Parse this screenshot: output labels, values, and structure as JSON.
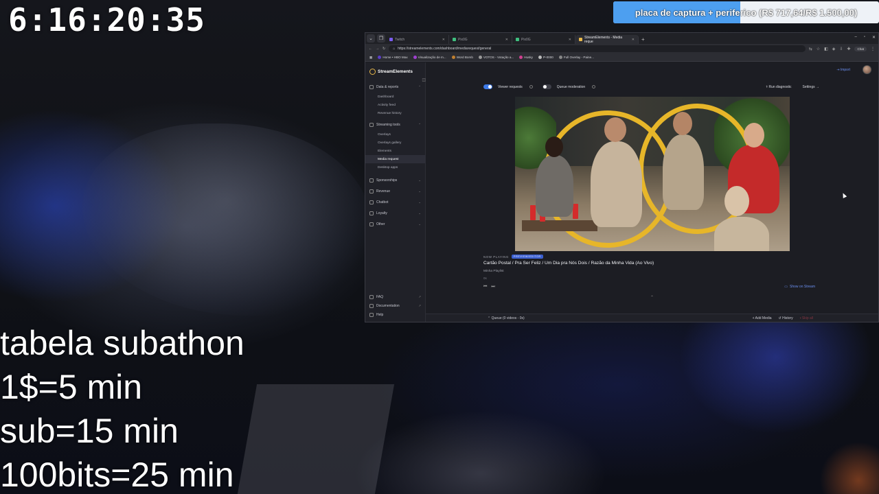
{
  "overlay": {
    "timer": "6:16:20:35",
    "goal": {
      "label": "placa de captura + periferico (R$ 717,64/R$ 1.500,00)",
      "progress": 0.478,
      "fill_color": "#4d9ff0",
      "bg_color": "#eef2f7"
    },
    "subathon_lines": [
      "tabela subathon",
      "1$=5 min",
      "sub=15 min",
      "100bits=25 min"
    ]
  },
  "browser": {
    "tabs": [
      {
        "title": "Twitch",
        "active": false
      },
      {
        "title": "Pix0G",
        "active": false
      },
      {
        "title": "Pix0G",
        "active": false
      },
      {
        "title": "StreamElements - Media reque",
        "active": true
      }
    ],
    "url": "https://streamelements.com/dashboard/mediarequest/general",
    "profile_chip": "Chat",
    "bookmarks": [
      "Home • HBO Max",
      "Visualização de m...",
      "Word Bomb",
      "VOTOS - Votação a...",
      "Husky",
      "P-0000",
      "Full Overlay - Paine..."
    ]
  },
  "app": {
    "brand": "StreamElements",
    "sidebar": {
      "sections": [
        {
          "label": "Data & reports",
          "items": [
            "Dashboard",
            "Activity feed",
            "Revenue history"
          ]
        },
        {
          "label": "Streaming tools",
          "items": [
            "Overlays",
            "Overlays gallery",
            "Elements",
            "Media request",
            "Desktop apps"
          ]
        },
        {
          "label": "Sponsorships",
          "items": []
        },
        {
          "label": "Revenue",
          "items": []
        },
        {
          "label": "Chatbot",
          "items": []
        },
        {
          "label": "Loyalty",
          "items": []
        },
        {
          "label": "Other",
          "items": []
        }
      ],
      "active_item": "Media request",
      "bottom": [
        "FAQ",
        "Documentation",
        "Help"
      ]
    },
    "import_label": "Import",
    "viewer_requests_label": "Viewer requests",
    "viewer_requests_on": true,
    "queue_moderation_label": "Queue moderation",
    "queue_moderation_on": false,
    "run_diagnostic_label": "Run diagnostic",
    "settings_label": "Settings",
    "now_playing_label": "NOW PLAYING",
    "now_playing_badge": "PREVIEW/EDITOR",
    "track_title": "Cartão Postal / Pra Ser Feliz / Um Dia pra Nós Dois / Razão da Minha Vida (Ao Vivo)",
    "track_playlist": "Minha Playlist",
    "track_extra": "0s",
    "show_on_stream_label": "Show on Stream",
    "queue_label": "Queue (0 videos - 0s)",
    "add_media_label": "Add Media",
    "history_label": "History",
    "skip_label": "Skip all"
  }
}
